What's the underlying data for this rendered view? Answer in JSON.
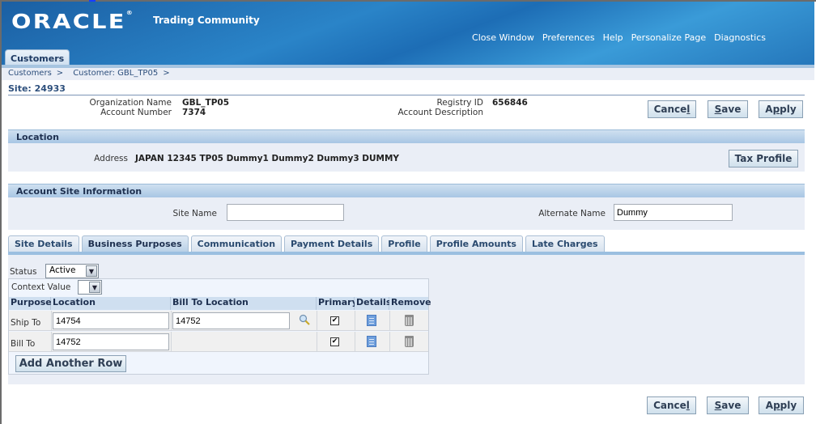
{
  "header": {
    "logo": "ORACLE",
    "logo_mark": "®",
    "app_name": "Trading Community",
    "global_links": [
      "Close Window",
      "Preferences",
      "Help",
      "Personalize Page",
      "Diagnostics"
    ],
    "main_tab": "Customers"
  },
  "breadcrumb": {
    "items": [
      "Customers",
      "Customer: GBL_TP05"
    ],
    "separator": ">"
  },
  "site": {
    "title": "Site: 24933",
    "organization_name_label": "Organization Name",
    "organization_name": "GBL_TP05",
    "account_number_label": "Account Number",
    "account_number": "7374",
    "registry_id_label": "Registry ID",
    "registry_id": "656846",
    "account_description_label": "Account Description",
    "account_description": ""
  },
  "buttons": {
    "cancel": "Cance",
    "cancel_u": "l",
    "save_u": "S",
    "save": "ave",
    "apply_a": "A",
    "apply_u": "p",
    "apply_b": "ply",
    "tax_profile": "Tax Profile",
    "add_row": "Add Another Row"
  },
  "location": {
    "header": "Location",
    "address_label": "Address",
    "address": "JAPAN 12345 TP05 Dummy1 Dummy2 Dummy3 DUMMY"
  },
  "account_site": {
    "header": "Account Site Information",
    "site_name_label": "Site Name",
    "site_name": "",
    "alternate_name_label": "Alternate Name",
    "alternate_name": "Dummy"
  },
  "tabs": [
    {
      "label": "Site Details",
      "active": false
    },
    {
      "label": "Business Purposes",
      "active": true
    },
    {
      "label": "Communication",
      "active": false
    },
    {
      "label": "Payment Details",
      "active": false
    },
    {
      "label": "Profile",
      "active": false
    },
    {
      "label": "Profile Amounts",
      "active": false
    },
    {
      "label": "Late Charges",
      "active": false
    }
  ],
  "business_purposes": {
    "status_label": "Status",
    "status_value": "Active",
    "context_label": "Context Value",
    "context_value": "",
    "columns": [
      "Purpose",
      "Location",
      "Bill To Location",
      "Primary",
      "Details",
      "Remove"
    ],
    "rows": [
      {
        "purpose": "Ship To",
        "location": "14754",
        "bill_to_location": "14752",
        "primary": true
      },
      {
        "purpose": "Bill To",
        "location": "14752",
        "bill_to_location": null,
        "primary": true
      }
    ],
    "check_glyph": "✔",
    "select_arrow": "▼"
  }
}
